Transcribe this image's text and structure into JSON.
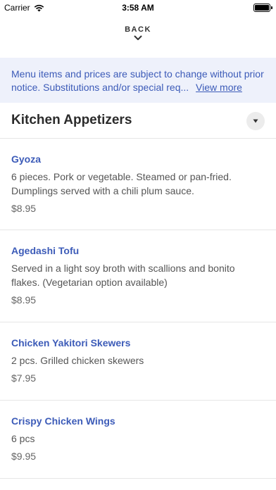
{
  "status_bar": {
    "carrier": "Carrier",
    "time": "3:58 AM",
    "icons": [
      "wifi-icon",
      "battery-icon"
    ]
  },
  "nav": {
    "back_label": "BACK",
    "back_icon": "chevron-down-icon"
  },
  "notice": {
    "text": "Menu items and prices are subject to change without prior notice. Substitutions and/or special req...",
    "link": "View more"
  },
  "section": {
    "title": "Kitchen Appetizers",
    "toggle_icon": "caret-down-icon"
  },
  "items": [
    {
      "name": "Gyoza",
      "description": "6 pieces. Pork or vegetable. Steamed or pan-fried. Dumplings served with a chili plum sauce.",
      "price": "$8.95"
    },
    {
      "name": "Agedashi Tofu",
      "description": "Served in a light soy broth with scallions and bonito flakes. (Vegetarian option available)",
      "price": "$8.95"
    },
    {
      "name": "Chicken Yakitori Skewers",
      "description": "2 pcs. Grilled chicken skewers",
      "price": "$7.95"
    },
    {
      "name": "Crispy Chicken Wings",
      "description": "6 pcs",
      "price": "$9.95"
    }
  ],
  "colors": {
    "accent": "#3c5bb8",
    "notice_bg": "#eef1fb",
    "divider": "#e6e6e6"
  }
}
